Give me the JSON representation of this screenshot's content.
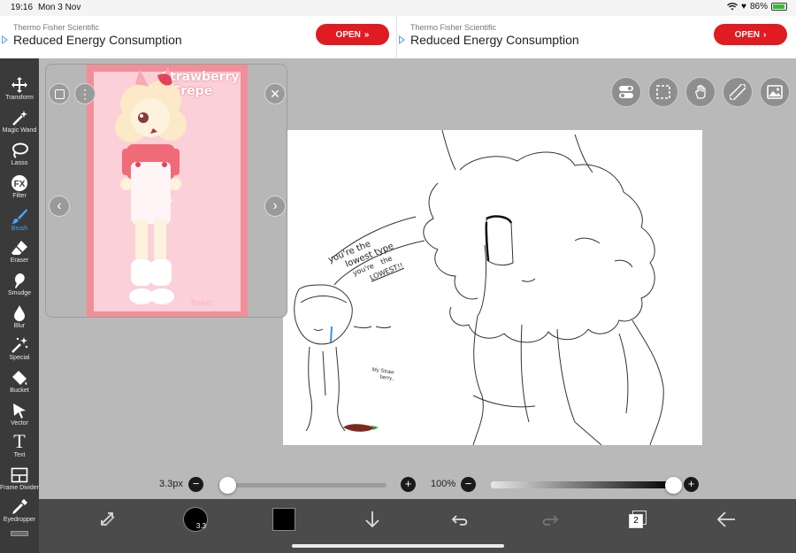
{
  "status": {
    "time": "19:16",
    "date": "Mon 3 Nov",
    "battery": "86%"
  },
  "ads": [
    {
      "sponsor": "Thermo Fisher Scientific",
      "headline": "Reduced Energy Consumption",
      "cta": "OPEN",
      "cta_icon": "double-chevron-icon"
    },
    {
      "sponsor": "Thermo Fisher Scientific",
      "headline": "Reduced Energy Consumption",
      "cta": "OPEN",
      "cta_icon": "chevron-right-icon"
    }
  ],
  "tools": [
    {
      "label": "Transform",
      "icon": "move-icon"
    },
    {
      "label": "Magic Wand",
      "icon": "magic-wand-icon"
    },
    {
      "label": "Lasso",
      "icon": "lasso-icon"
    },
    {
      "label": "Filter",
      "icon": "fx-icon",
      "glyph": "FX"
    },
    {
      "label": "Brush",
      "icon": "brush-icon",
      "active": true
    },
    {
      "label": "Eraser",
      "icon": "eraser-icon"
    },
    {
      "label": "Smudge",
      "icon": "smudge-icon"
    },
    {
      "label": "Blur",
      "icon": "blur-drop-icon"
    },
    {
      "label": "Special",
      "icon": "special-sparkle-icon"
    },
    {
      "label": "Bucket",
      "icon": "bucket-icon"
    },
    {
      "label": "Vector",
      "icon": "vector-cursor-icon"
    },
    {
      "label": "Text",
      "icon": "text-icon",
      "glyph": "T"
    },
    {
      "label": "Frame Divider",
      "icon": "frame-divider-icon"
    },
    {
      "label": "Eyedropper",
      "icon": "eyedropper-icon"
    }
  ],
  "reference": {
    "title_line1": "Strawberry",
    "title_line2": "Crepe",
    "side_text": "foxket",
    "signature": "foxket",
    "colors": {
      "background": "#f28e98",
      "inner": "#fbd0d8"
    }
  },
  "sketch": {
    "speech": [
      "you're the",
      "lowest type",
      "you're",
      "the",
      "LOWEST!!"
    ],
    "small_note": [
      "My Straw",
      "berry.."
    ]
  },
  "brush": {
    "size": "3.3px",
    "size_fraction": 0.05,
    "opacity": "100%",
    "opacity_fraction": 1.0
  },
  "bottom": {
    "brush_size_badge": "3.3",
    "primary_color": "#000000",
    "layer_count": "2"
  },
  "colors": {
    "accent": "#4aa3ff",
    "toolbar": "#3a3a3a",
    "bottom_bar": "#4b4b4b",
    "ad_button": "#e01b22"
  }
}
